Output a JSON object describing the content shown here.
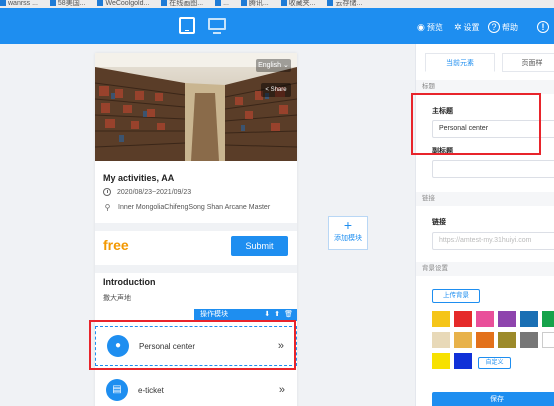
{
  "browser": {
    "bookmarks": [
      "wanrss ...",
      "58美国...",
      "WeCoolgold...",
      "在线画图...",
      "...",
      "腾讯...",
      "收藏夹...",
      "云存储..."
    ]
  },
  "toolbar": {
    "preview_label": "预览",
    "settings_label": "设置",
    "help_label": "帮助"
  },
  "phone": {
    "lang_button": "English",
    "share_button": "Share",
    "activity_title": "My activities, AA",
    "date_range": "2020/08/23~2021/09/23",
    "address": "Inner MongoliaChifengSong Shan Arcane Master",
    "price": "free",
    "submit_label": "Submit",
    "intro_title": "Introduction",
    "intro_text": "撒大声地",
    "op_bar_label": "操作模块",
    "menu_items": [
      {
        "label": "Personal center",
        "icon": "user-icon"
      },
      {
        "label": "e-ticket",
        "icon": "ticket-icon"
      }
    ]
  },
  "add_module": {
    "label": "添加模块"
  },
  "panel": {
    "tabs": [
      "当前元素",
      "页面样"
    ],
    "title_section": "标题",
    "main_title_label": "主标题",
    "main_title_value": "Personal center",
    "sub_title_label": "副标题",
    "sub_title_value": "",
    "link_section": "链接",
    "link_label": "链接",
    "link_placeholder": "https://amtest-my.31huiyi.com",
    "bg_section": "背景设置",
    "upload_label": "上传背景",
    "custom_label": "自定义",
    "save_label": "保存",
    "swatches": [
      "#f5c518",
      "#e52a2a",
      "#e94f9a",
      "#8e44ad",
      "#1a6fb4",
      "#16a34a",
      "#e8d9b8",
      "#e8b24a",
      "#e3711b",
      "#9c8a2a",
      "#777777",
      "#ffffff",
      "#f7e100",
      "#1031d8"
    ]
  }
}
